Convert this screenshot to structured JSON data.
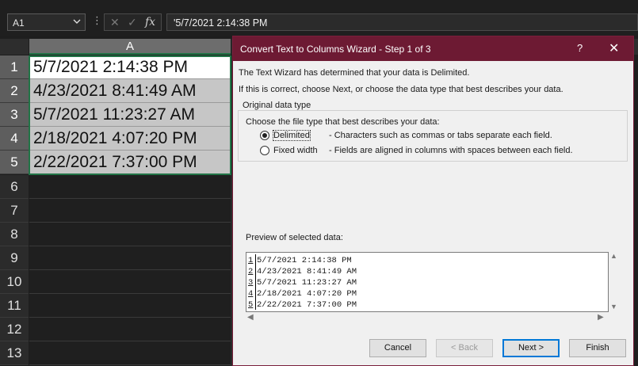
{
  "namebox": {
    "value": "A1"
  },
  "formula_bar": {
    "dots": "⋮",
    "cancel_icon": "✕",
    "enter_icon": "✓",
    "fx": "fx",
    "value": "'5/7/2021 2:14:38 PM"
  },
  "sheet": {
    "column_header": "A",
    "row_numbers": [
      "1",
      "2",
      "3",
      "4",
      "5",
      "6",
      "7",
      "8",
      "9",
      "10",
      "11",
      "12",
      "13"
    ],
    "cells": [
      "5/7/2021 2:14:38 PM",
      "4/23/2021 8:41:49 AM",
      "5/7/2021 11:23:27 AM",
      "2/18/2021 4:07:20 PM",
      "2/22/2021 7:37:00 PM"
    ]
  },
  "dialog": {
    "title": "Convert Text to Columns Wizard - Step 1 of 3",
    "help": "?",
    "close": "✕",
    "intro1": "The Text Wizard has determined that your data is Delimited.",
    "intro2": "If this is correct, choose Next, or choose the data type that best describes your data.",
    "group_label": "Original data type",
    "choose_label": "Choose the file type that best describes your data:",
    "options": [
      {
        "label": "Delimited",
        "desc": "- Characters such as commas or tabs separate each field.",
        "selected": true
      },
      {
        "label": "Fixed width",
        "desc": "- Fields are aligned in columns with spaces between each field.",
        "selected": false
      }
    ],
    "preview_label": "Preview of selected data:",
    "preview_rows": [
      {
        "n": "1",
        "text": "5/7/2021 2:14:38 PM"
      },
      {
        "n": "2",
        "text": "4/23/2021 8:41:49 AM"
      },
      {
        "n": "3",
        "text": "5/7/2021 11:23:27 AM"
      },
      {
        "n": "4",
        "text": "2/18/2021 4:07:20 PM"
      },
      {
        "n": "5",
        "text": "2/22/2021 7:37:00 PM"
      }
    ],
    "buttons": {
      "cancel": "Cancel",
      "back": "< Back",
      "next": "Next >",
      "finish": "Finish"
    }
  }
}
